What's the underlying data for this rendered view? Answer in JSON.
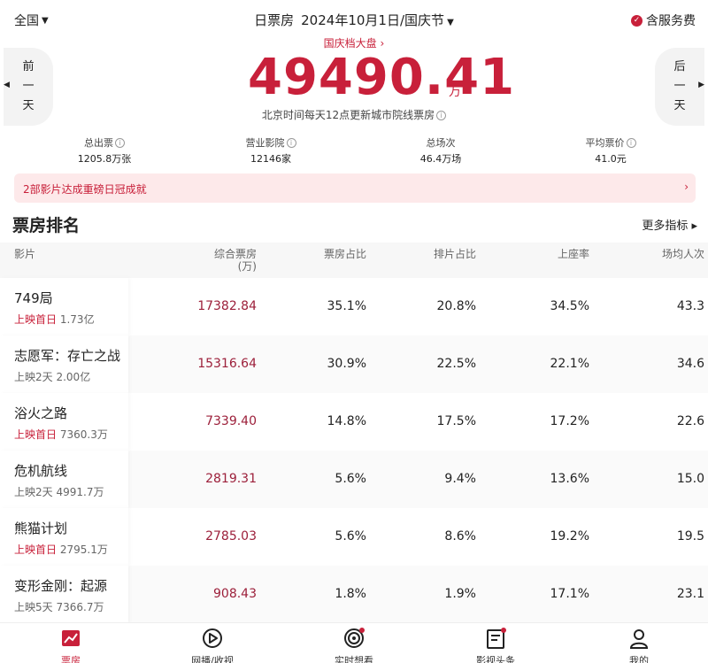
{
  "header": {
    "region": "全国",
    "title_prefix": "日票房",
    "date_label": "2024年10月1日/国庆节",
    "fee_label": "含服务费"
  },
  "hero": {
    "link": "国庆档大盘",
    "total": "49490.41",
    "unit": "万",
    "note": "北京时间每天12点更新城市院线票房",
    "prev_day": [
      "前",
      "一",
      "天"
    ],
    "next_day": [
      "后",
      "一",
      "天"
    ]
  },
  "stats": [
    {
      "label": "总出票",
      "value": "1205.8万张",
      "info": true
    },
    {
      "label": "营业影院",
      "value": "12146家",
      "info": true
    },
    {
      "label": "总场次",
      "value": "46.4万场",
      "info": false
    },
    {
      "label": "平均票价",
      "value": "41.0元",
      "info": true
    }
  ],
  "banner": {
    "text": "2部影片达成重磅日冠成就",
    "arrow": "›"
  },
  "ranking": {
    "title": "票房排名",
    "more": "更多指标 ▸",
    "columns": {
      "film": "影片",
      "box": "综合票房",
      "box_unit": "(万)",
      "box_share": "票房占比",
      "show_share": "排片占比",
      "occupancy": "上座率",
      "avg_people": "场均人次"
    },
    "rows": [
      {
        "name": "749局",
        "sub_label": "上映首日",
        "sub_value": "1.73亿",
        "sub_red": true,
        "box": "17382.84",
        "box_share": "35.1%",
        "show_share": "20.8%",
        "occupancy": "34.5%",
        "avg_people": "43.3"
      },
      {
        "name": "志愿军：存亡之战",
        "sub_label": "上映2天",
        "sub_value": "2.00亿",
        "sub_red": false,
        "box": "15316.64",
        "box_share": "30.9%",
        "show_share": "22.5%",
        "occupancy": "22.1%",
        "avg_people": "34.6"
      },
      {
        "name": "浴火之路",
        "sub_label": "上映首日",
        "sub_value": "7360.3万",
        "sub_red": true,
        "box": "7339.40",
        "box_share": "14.8%",
        "show_share": "17.5%",
        "occupancy": "17.2%",
        "avg_people": "22.6"
      },
      {
        "name": "危机航线",
        "sub_label": "上映2天",
        "sub_value": "4991.7万",
        "sub_red": false,
        "box": "2819.31",
        "box_share": "5.6%",
        "show_share": "9.4%",
        "occupancy": "13.6%",
        "avg_people": "15.0"
      },
      {
        "name": "熊猫计划",
        "sub_label": "上映首日",
        "sub_value": "2795.1万",
        "sub_red": true,
        "box": "2785.03",
        "box_share": "5.6%",
        "show_share": "8.6%",
        "occupancy": "19.2%",
        "avg_people": "19.5"
      },
      {
        "name": "变形金刚：起源",
        "sub_label": "上映5天",
        "sub_value": "7366.7万",
        "sub_red": false,
        "box": "908.43",
        "box_share": "1.8%",
        "show_share": "1.9%",
        "occupancy": "17.1%",
        "avg_people": "23.1"
      }
    ]
  },
  "nav": [
    {
      "label": "票房",
      "icon": "chart-icon",
      "active": true
    },
    {
      "label": "网播/收视",
      "icon": "play-icon",
      "active": false
    },
    {
      "label": "实时想看",
      "icon": "broadcast-icon",
      "active": false
    },
    {
      "label": "影视头条",
      "icon": "news-icon",
      "active": false
    },
    {
      "label": "我的",
      "icon": "user-icon",
      "active": false
    }
  ],
  "colors": {
    "accent": "#c8203a",
    "box_value": "#9c1f3a",
    "banner_bg": "#fde9ea"
  }
}
